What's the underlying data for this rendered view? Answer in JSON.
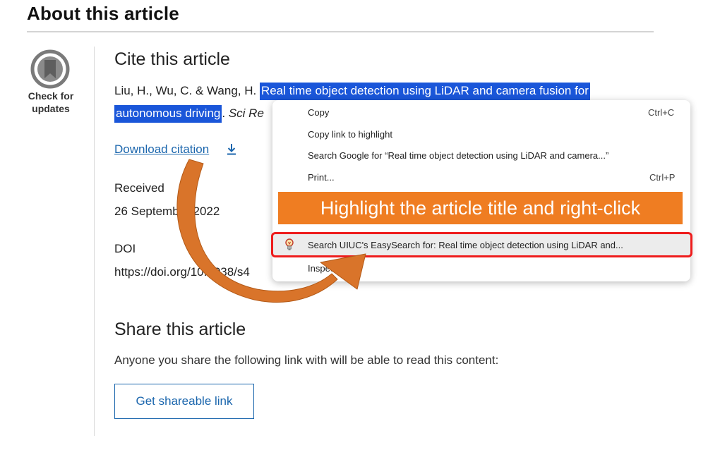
{
  "page": {
    "heading": "About this article"
  },
  "check_for_updates": {
    "label_line1": "Check for",
    "label_line2": "updates"
  },
  "cite": {
    "title": "Cite this article",
    "authors": "Liu, H., Wu, C. & Wang, H. ",
    "article_title_part1": "Real time object detection using LiDAR and camera fusion for",
    "article_title_part2": "autonomous driving",
    "after_title": ". ",
    "journal_partial": "Sci Re",
    "download_label": "Download citation"
  },
  "meta": {
    "received_label": "Received",
    "received_value": "26 September 2022",
    "doi_label": "DOI",
    "doi_value": "https://doi.org/10.1038/s4"
  },
  "share": {
    "title": "Share this article",
    "description": "Anyone you share the following link with will be able to read this content:",
    "button_label": "Get shareable link"
  },
  "context_menu": {
    "copy": "Copy",
    "copy_shortcut": "Ctrl+C",
    "copy_link": "Copy link to highlight",
    "search_google": "Search Google for “Real time object detection using LiDAR and camera...”",
    "print": "Print...",
    "print_shortcut": "Ctrl+P",
    "easysearch": "Search UIUC's EasySearch for: Real time object detection using LiDAR and...",
    "inspect": "Inspect"
  },
  "annotation": {
    "banner_text": "Highlight the article title and right-click"
  },
  "colors": {
    "highlight": "#1a56d9",
    "link": "#1b66ad",
    "banner": "#ef7d22",
    "callout_border": "#ee1c1c",
    "arrow": "#d9742a"
  },
  "icons": {
    "check_for_updates": "bookmark-circle-icon",
    "download": "download-arrow-icon",
    "easysearch": "lightbulb-icon",
    "annotation_arrow": "curved-arrow-icon"
  }
}
